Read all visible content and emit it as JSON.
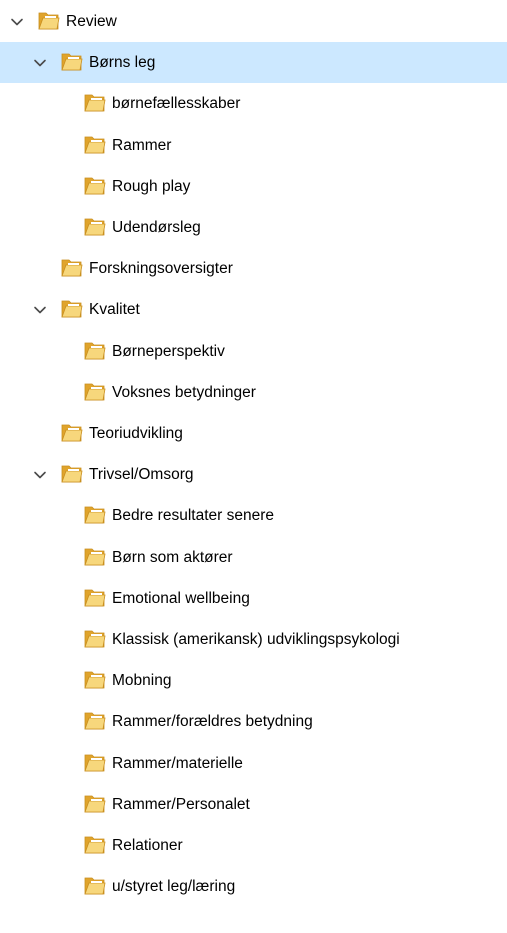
{
  "tree": {
    "colors": {
      "selected_bg": "#cce8ff",
      "chevron": "#4a4a4a",
      "folder_back": "#e0a42c",
      "folder_front": "#f7d77c",
      "folder_edge": "#c98f1f"
    },
    "items": [
      {
        "label": "Review",
        "depth": 0,
        "expanded": true,
        "selected": false,
        "icon": "folder-icon"
      },
      {
        "label": "Børns leg",
        "depth": 1,
        "expanded": true,
        "selected": true,
        "icon": "folder-icon"
      },
      {
        "label": "børnefællesskaber",
        "depth": 2,
        "expanded": null,
        "selected": false,
        "icon": "folder-icon"
      },
      {
        "label": "Rammer",
        "depth": 2,
        "expanded": null,
        "selected": false,
        "icon": "folder-icon"
      },
      {
        "label": "Rough play",
        "depth": 2,
        "expanded": null,
        "selected": false,
        "icon": "folder-icon"
      },
      {
        "label": "Udendørsleg",
        "depth": 2,
        "expanded": null,
        "selected": false,
        "icon": "folder-icon"
      },
      {
        "label": "Forskningsoversigter",
        "depth": 1,
        "expanded": null,
        "selected": false,
        "icon": "folder-icon"
      },
      {
        "label": "Kvalitet",
        "depth": 1,
        "expanded": true,
        "selected": false,
        "icon": "folder-icon"
      },
      {
        "label": "Børneperspektiv",
        "depth": 2,
        "expanded": null,
        "selected": false,
        "icon": "folder-icon"
      },
      {
        "label": "Voksnes betydninger",
        "depth": 2,
        "expanded": null,
        "selected": false,
        "icon": "folder-icon"
      },
      {
        "label": "Teoriudvikling",
        "depth": 1,
        "expanded": null,
        "selected": false,
        "icon": "folder-icon"
      },
      {
        "label": "Trivsel/Omsorg",
        "depth": 1,
        "expanded": true,
        "selected": false,
        "icon": "folder-icon"
      },
      {
        "label": "Bedre resultater senere",
        "depth": 2,
        "expanded": null,
        "selected": false,
        "icon": "folder-icon"
      },
      {
        "label": "Børn som aktører",
        "depth": 2,
        "expanded": null,
        "selected": false,
        "icon": "folder-icon"
      },
      {
        "label": "Emotional wellbeing",
        "depth": 2,
        "expanded": null,
        "selected": false,
        "icon": "folder-icon"
      },
      {
        "label": "Klassisk (amerikansk) udviklingspsykologi",
        "depth": 2,
        "expanded": null,
        "selected": false,
        "icon": "folder-icon"
      },
      {
        "label": "Mobning",
        "depth": 2,
        "expanded": null,
        "selected": false,
        "icon": "folder-icon"
      },
      {
        "label": "Rammer/forældres betydning",
        "depth": 2,
        "expanded": null,
        "selected": false,
        "icon": "folder-icon"
      },
      {
        "label": "Rammer/materielle",
        "depth": 2,
        "expanded": null,
        "selected": false,
        "icon": "folder-icon"
      },
      {
        "label": "Rammer/Personalet",
        "depth": 2,
        "expanded": null,
        "selected": false,
        "icon": "folder-icon"
      },
      {
        "label": "Relationer",
        "depth": 2,
        "expanded": null,
        "selected": false,
        "icon": "folder-icon"
      },
      {
        "label": "u/styret leg/læring",
        "depth": 2,
        "expanded": null,
        "selected": false,
        "icon": "folder-icon"
      }
    ]
  }
}
